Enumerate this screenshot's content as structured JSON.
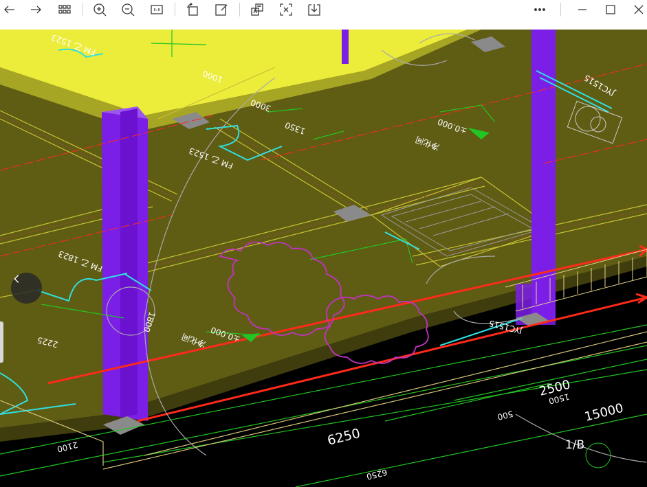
{
  "toolbar": {
    "icons": [
      "back-icon",
      "forward-icon",
      "grid-view-icon",
      "zoom-in-icon",
      "zoom-out-icon",
      "actual-size-icon",
      "rotate-icon",
      "edit-icon",
      "translate-icon",
      "ocr-icon",
      "save-icon",
      "more-icon",
      "minimize-icon",
      "maximize-icon",
      "close-icon"
    ]
  },
  "drawing": {
    "dim_6250": "6250",
    "dim_6250_small": "6250",
    "dim_2500": "2500",
    "dim_1500": "1500",
    "dim_15000": "15000",
    "dim_500": "500",
    "dim_2100": "2100",
    "dim_2225": "2225",
    "dim_1800": "1800",
    "axis_1b": "1/B",
    "label_fm1": "FM 乙 1523",
    "label_fm2": "FM 乙 1823",
    "label_fm3": "FM 乙 1523",
    "label_jyc": "JYC1515",
    "label_jyc2": "JYC1515",
    "label_lev1": "±0.000",
    "label_lev2": "±0.000",
    "label_room": "净化间",
    "label_room2": "净化间",
    "label_1350": "1350",
    "label_3000": "3000",
    "label_1000": "1000"
  },
  "colors": {
    "floor": "#5f5c14",
    "wall_top": "#ecec3a",
    "column": "#7c1fe6",
    "grid_green": "#22c622",
    "red_axis": "#ff2a1a",
    "cloud": "#c233c2"
  }
}
